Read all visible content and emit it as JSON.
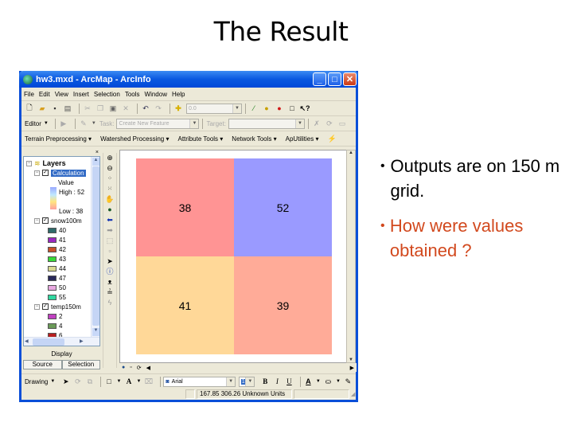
{
  "slide": {
    "title": "The Result",
    "bullets": [
      {
        "text": "Outputs are on 150 m grid.",
        "color": "#000000"
      },
      {
        "text": "How were values obtained ?",
        "color": "#d2491e"
      }
    ]
  },
  "window": {
    "title": "hw3.mxd - ArcMap - ArcInfo",
    "controls": {
      "minimize": "_",
      "maximize": "□",
      "close": "✕"
    }
  },
  "menubar": [
    "File",
    "Edit",
    "View",
    "Insert",
    "Selection",
    "Tools",
    "Window",
    "Help"
  ],
  "standard_toolbar": {
    "scale_value": "0.0",
    "icons": [
      "new-icon",
      "open-icon",
      "save-icon",
      "print-icon",
      "cut-icon",
      "copy-icon",
      "paste-icon",
      "delete-icon",
      "undo-icon",
      "redo-icon",
      "add-data-icon",
      "editor-toolbar-icon",
      "arctoolbox-icon",
      "arccatalog-icon",
      "command-line-icon",
      "whats-this-icon"
    ]
  },
  "editor_toolbar": {
    "editor_label": "Editor",
    "task_label": "Task:",
    "task_value": "Create New Feature",
    "target_label": "Target:",
    "target_value": ""
  },
  "extension_toolbar": [
    "Terrain Preprocessing",
    "Watershed Processing",
    "Attribute Tools",
    "Network Tools",
    "ApUtilities"
  ],
  "toc": {
    "root": "Layers",
    "layers": [
      {
        "name": "Calculation",
        "selected": true,
        "legend_title": "Value",
        "high": "High : 52",
        "low": "Low : 38"
      },
      {
        "name": "snow100m",
        "classes": [
          {
            "label": "40",
            "color": "#2f6a6a"
          },
          {
            "label": "41",
            "color": "#9a28c0"
          },
          {
            "label": "42",
            "color": "#c8502a"
          },
          {
            "label": "43",
            "color": "#38d838"
          },
          {
            "label": "44",
            "color": "#d8d890"
          },
          {
            "label": "47",
            "color": "#28285a"
          },
          {
            "label": "50",
            "color": "#e8a8e0"
          },
          {
            "label": "55",
            "color": "#30d8a0"
          }
        ]
      },
      {
        "name": "temp150m",
        "classes": [
          {
            "label": "2",
            "color": "#c040c0"
          },
          {
            "label": "4",
            "color": "#6a9a58"
          },
          {
            "label": "6",
            "color": "#b82020"
          }
        ]
      }
    ],
    "display_label": "Display",
    "tabs": [
      "Source",
      "Selection"
    ]
  },
  "tools_toolbar": [
    "zoom-in-icon",
    "zoom-out-icon",
    "fixed-zoom-in-icon",
    "fixed-zoom-out-icon",
    "pan-icon",
    "full-extent-icon",
    "back-extent-icon",
    "forward-extent-icon",
    "select-features-icon",
    "clear-selection-icon",
    "select-elements-icon",
    "identify-icon",
    "find-icon",
    "measure-icon",
    "hyperlink-icon"
  ],
  "map": {
    "grid": [
      {
        "value": "38",
        "color": "#ff9494"
      },
      {
        "value": "52",
        "color": "#9a9aff"
      },
      {
        "value": "41",
        "color": "#ffd898"
      },
      {
        "value": "39",
        "color": "#ffab98"
      }
    ]
  },
  "drawing_toolbar": {
    "drawing_label": "Drawing",
    "font": "Arial",
    "font_size": "10",
    "bold": "B",
    "italic": "I",
    "underline": "U"
  },
  "statusbar": {
    "coordinates": "167.85  306.26 Unknown Units"
  }
}
